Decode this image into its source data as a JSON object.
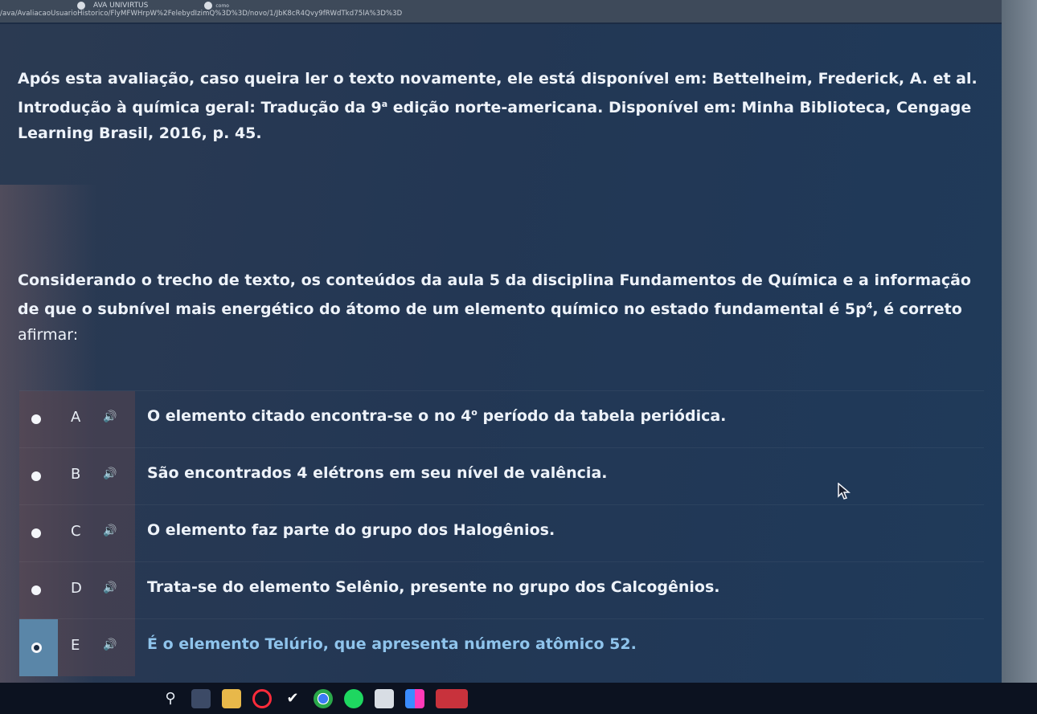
{
  "browser": {
    "tab_title": "AVA UNIVIRTUS",
    "tab_title_secondary": "como",
    "url": "/ava/AvaliacaoUsuarioHistorico/FlyMFWHrpW%2FelebydIzimQ%3D%3D/novo/1/JbK8cR4Qvy9fRWdTkd75lA%3D%3D"
  },
  "question": {
    "intro_text": "Após esta avaliação, caso queira ler o texto novamente, ele está disponível em: Bettelheim, Frederick, A. et al. Introdução à química geral: Tradução da ",
    "intro_edition_number": "9",
    "intro_edition_superscript": "a",
    "intro_text_end": " edição norte-americana. Disponível em: Minha Biblioteca, Cengage Learning Brasil, 2016, p. 45.",
    "prompt_text": "Considerando o trecho de texto, os conteúdos da aula 5 da disciplina Fundamentos de Química e a informação de que o subnível mais energético do átomo de um elemento químico no estado fundamental é ",
    "prompt_orbital": "5p",
    "prompt_orbital_superscript": "4",
    "prompt_text_end": ", é correto",
    "prompt_last_line": "afirmar:"
  },
  "options": [
    {
      "letter": "A",
      "text": "O elemento citado encontra-se o no ",
      "sup_base": "4",
      "sup": "o",
      "text_end": " período da tabela periódica.",
      "selected": false
    },
    {
      "letter": "B",
      "text": "São encontrados 4 elétrons em seu nível de valência.",
      "selected": false
    },
    {
      "letter": "C",
      "text": "O elemento faz parte do grupo dos Halogênios.",
      "selected": false
    },
    {
      "letter": "D",
      "text": "Trata-se do elemento Selênio, presente no grupo dos Calcogênios.",
      "selected": false
    },
    {
      "letter": "E",
      "text": "É o elemento Telúrio, que apresenta número atômico 52.",
      "selected": true
    }
  ],
  "icons": {
    "speaker": "🔊",
    "search": "⚲",
    "check": "✔"
  },
  "colors": {
    "selected_text": "#8fc4ec",
    "selected_radio_bg": "#5a86a8",
    "panel_bg": "#233754"
  }
}
